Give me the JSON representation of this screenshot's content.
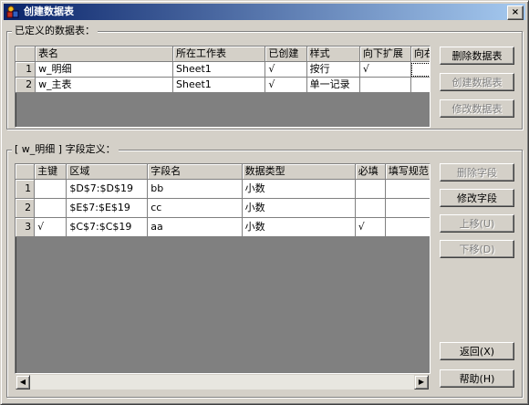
{
  "window": {
    "title": "创建数据表",
    "close_label": "×"
  },
  "tables_group": {
    "legend": "已定义的数据表：",
    "columns": [
      "",
      "表名",
      "所在工作表",
      "已创建",
      "样式",
      "向下扩展",
      "向右扩展"
    ],
    "rows": [
      {
        "num": "1",
        "name": "w_明细",
        "sheet": "Sheet1",
        "created": "√",
        "style": "按行",
        "down": "√",
        "right": ""
      },
      {
        "num": "2",
        "name": "w_主表",
        "sheet": "Sheet1",
        "created": "√",
        "style": "单一记录",
        "down": "",
        "right": ""
      }
    ],
    "buttons": {
      "delete": "删除数据表",
      "create": "创建数据表",
      "modify": "修改数据表"
    }
  },
  "fields_group": {
    "legend": "[ w_明细 ] 字段定义：",
    "columns": [
      "",
      "主键",
      "区域",
      "字段名",
      "数据类型",
      "必填",
      "填写规范"
    ],
    "rows": [
      {
        "num": "1",
        "pk": "",
        "range": "$D$7:$D$19",
        "field": "bb",
        "type": "小数",
        "required": "",
        "rule": ""
      },
      {
        "num": "2",
        "pk": "",
        "range": "$E$7:$E$19",
        "field": "cc",
        "type": "小数",
        "required": "",
        "rule": ""
      },
      {
        "num": "3",
        "pk": "√",
        "range": "$C$7:$C$19",
        "field": "aa",
        "type": "小数",
        "required": "√",
        "rule": ""
      }
    ],
    "buttons": {
      "delete": "删除字段",
      "modify": "修改字段",
      "up": "上移(U)",
      "down": "下移(D)"
    }
  },
  "footer": {
    "back": "返回(X)",
    "help": "帮助(H)"
  },
  "icons": {
    "app": "app-icon",
    "scroll_left": "left-arrow-icon",
    "scroll_right": "right-arrow-icon"
  },
  "colors": {
    "title_start": "#0a246a",
    "title_end": "#a6caf0",
    "face": "#d4d0c8",
    "grid_empty": "#808080"
  }
}
